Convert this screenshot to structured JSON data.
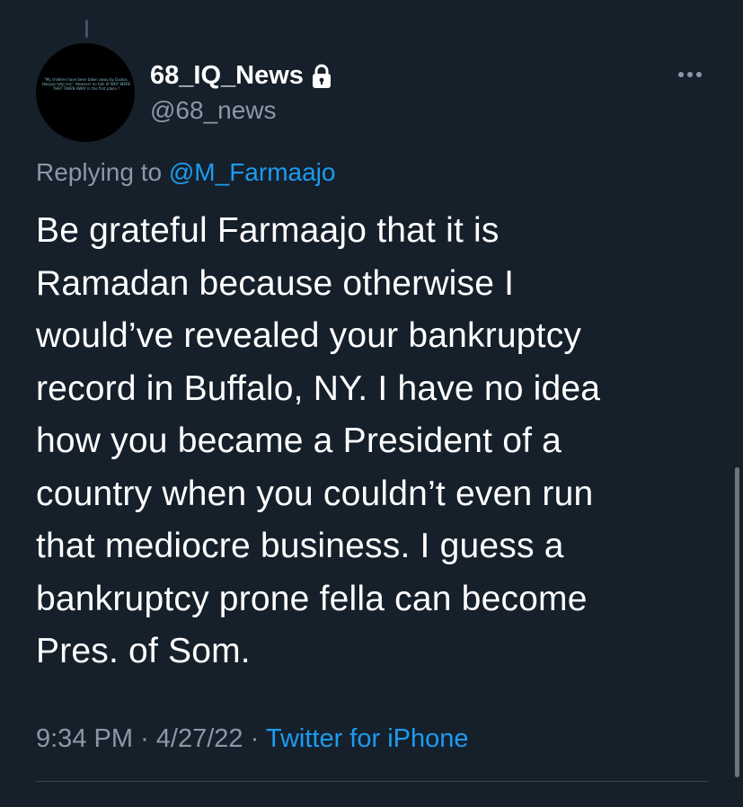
{
  "tweet": {
    "display_name": "68_IQ_News",
    "handle": "@68_news",
    "avatar_caption": "\"My children have been taken away by Gaalos. Hooyoo help me\". However no talk of WHY WERE THEY TAKEN AWAY in the first place ?",
    "replying_prefix": "Replying to",
    "replying_to": "@M_Farmaajo",
    "text_lines": [
      "Be grateful Farmaajo that it is",
      "Ramadan because otherwise I",
      "would’ve revealed your bankruptcy",
      "record in Buffalo, NY. I have no idea",
      "how you became a President of a",
      "country when you couldn’t even run",
      "that mediocre business. I guess a",
      "bankruptcy prone fella can become",
      "Pres. of Som."
    ],
    "time": "9:34 PM",
    "separator": "·",
    "date": "4/27/22",
    "source": "Twitter for iPhone"
  },
  "icons": {
    "protected": "lock-icon",
    "more": "more-icon"
  },
  "colors": {
    "background": "#15202b",
    "primary_text": "#ffffff",
    "secondary_text": "#8b98a5",
    "accent": "#1d9bf0",
    "divider": "#38444d"
  }
}
